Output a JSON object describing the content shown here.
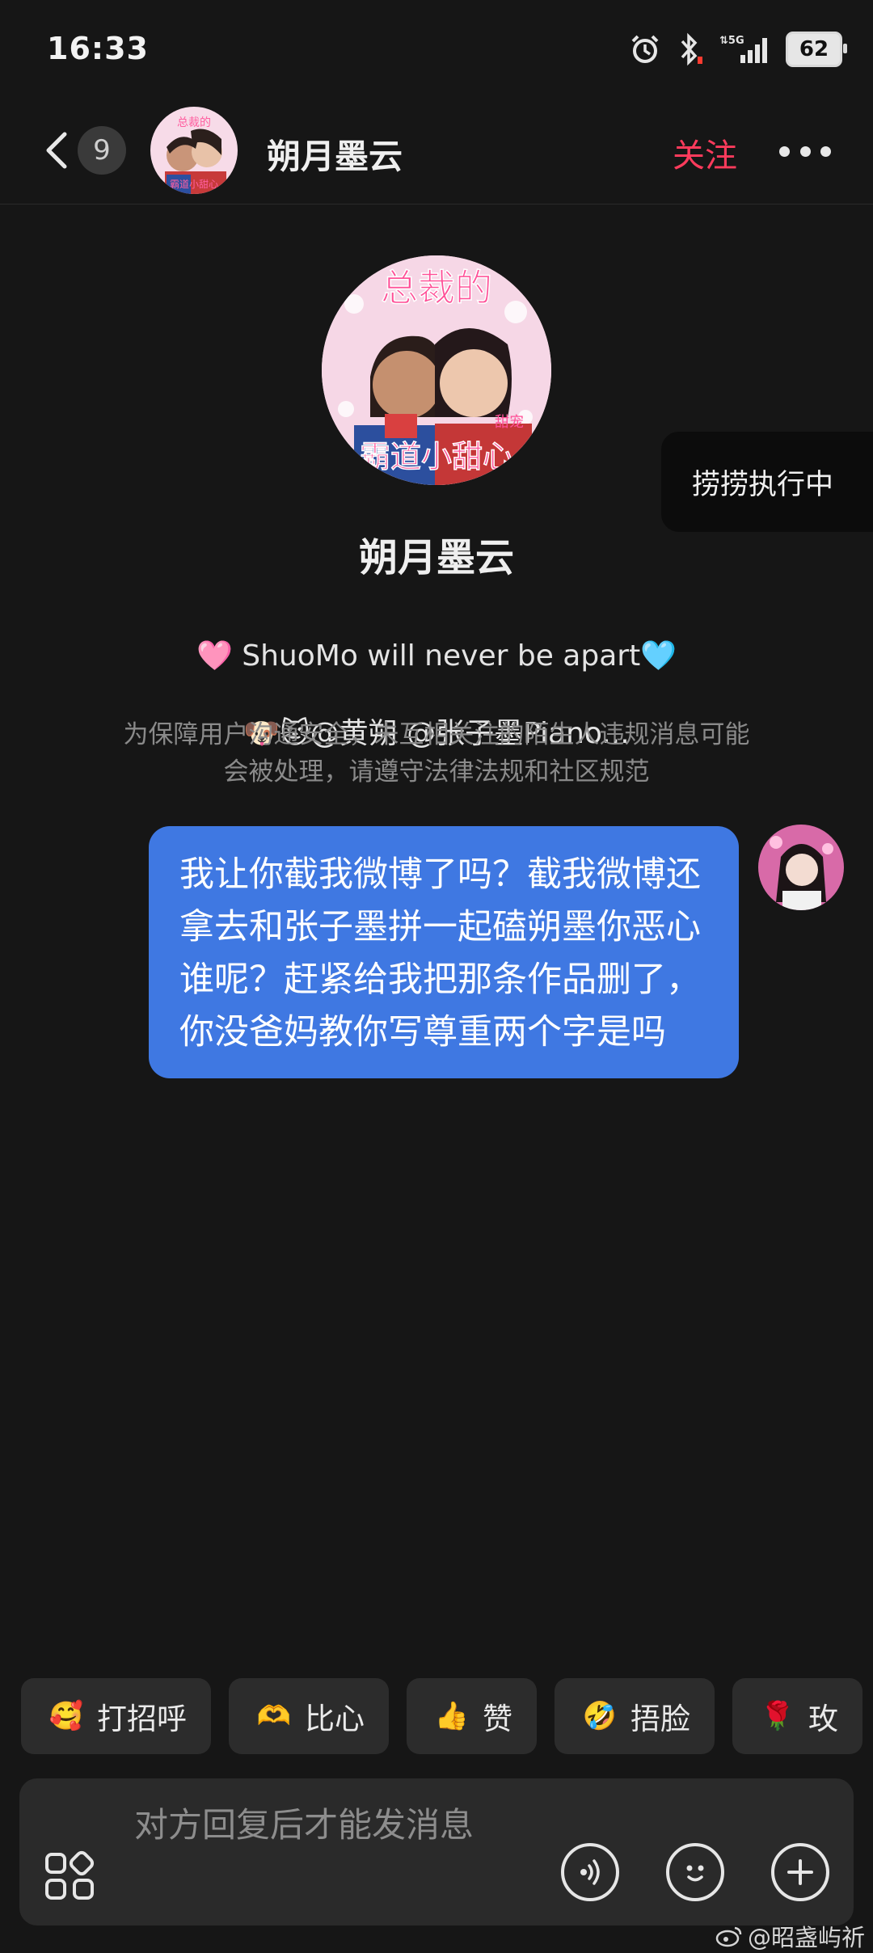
{
  "status_bar": {
    "time": "16:33",
    "battery": "62"
  },
  "header": {
    "unread_count": "9",
    "name": "朔月墨云",
    "follow_label": "关注"
  },
  "profile": {
    "name": "朔月墨云",
    "bio_line1": "🩷 ShuoMo will never be apart🩵",
    "bio_line2": "🐶🐱@黄朔 @张子墨Piano...",
    "notice": "为保障用户沟通安全，未互相关注的陌生人违规消息可能会被处理，请遵守法律法规和社区规范",
    "avatar_caption_top": "总裁的",
    "avatar_caption_bottom": "霸道小甜心",
    "avatar_caption_tag": "甜宠"
  },
  "toast": {
    "text": "捞捞执行中"
  },
  "messages": [
    {
      "text": "我让你截我微博了吗？截我微博还拿去和张子墨拼一起磕朔墨你恶心谁呢？赶紧给我把那条作品删了，你没爸妈教你写尊重两个字是吗"
    }
  ],
  "quick_replies": [
    {
      "emoji": "🥰",
      "label": "打招呼"
    },
    {
      "emoji": "🫶",
      "label": "比心"
    },
    {
      "emoji": "👍",
      "label": "赞"
    },
    {
      "emoji": "🤣",
      "label": "捂脸"
    },
    {
      "emoji": "🌹",
      "label": "玫"
    }
  ],
  "input": {
    "placeholder": "对方回复后才能发消息"
  },
  "watermark": {
    "text": "@昭盏屿祈"
  },
  "colors": {
    "background": "#161616",
    "bubble": "#3f78e2",
    "follow": "#ff3b5c",
    "chip": "#2c2c2c"
  }
}
